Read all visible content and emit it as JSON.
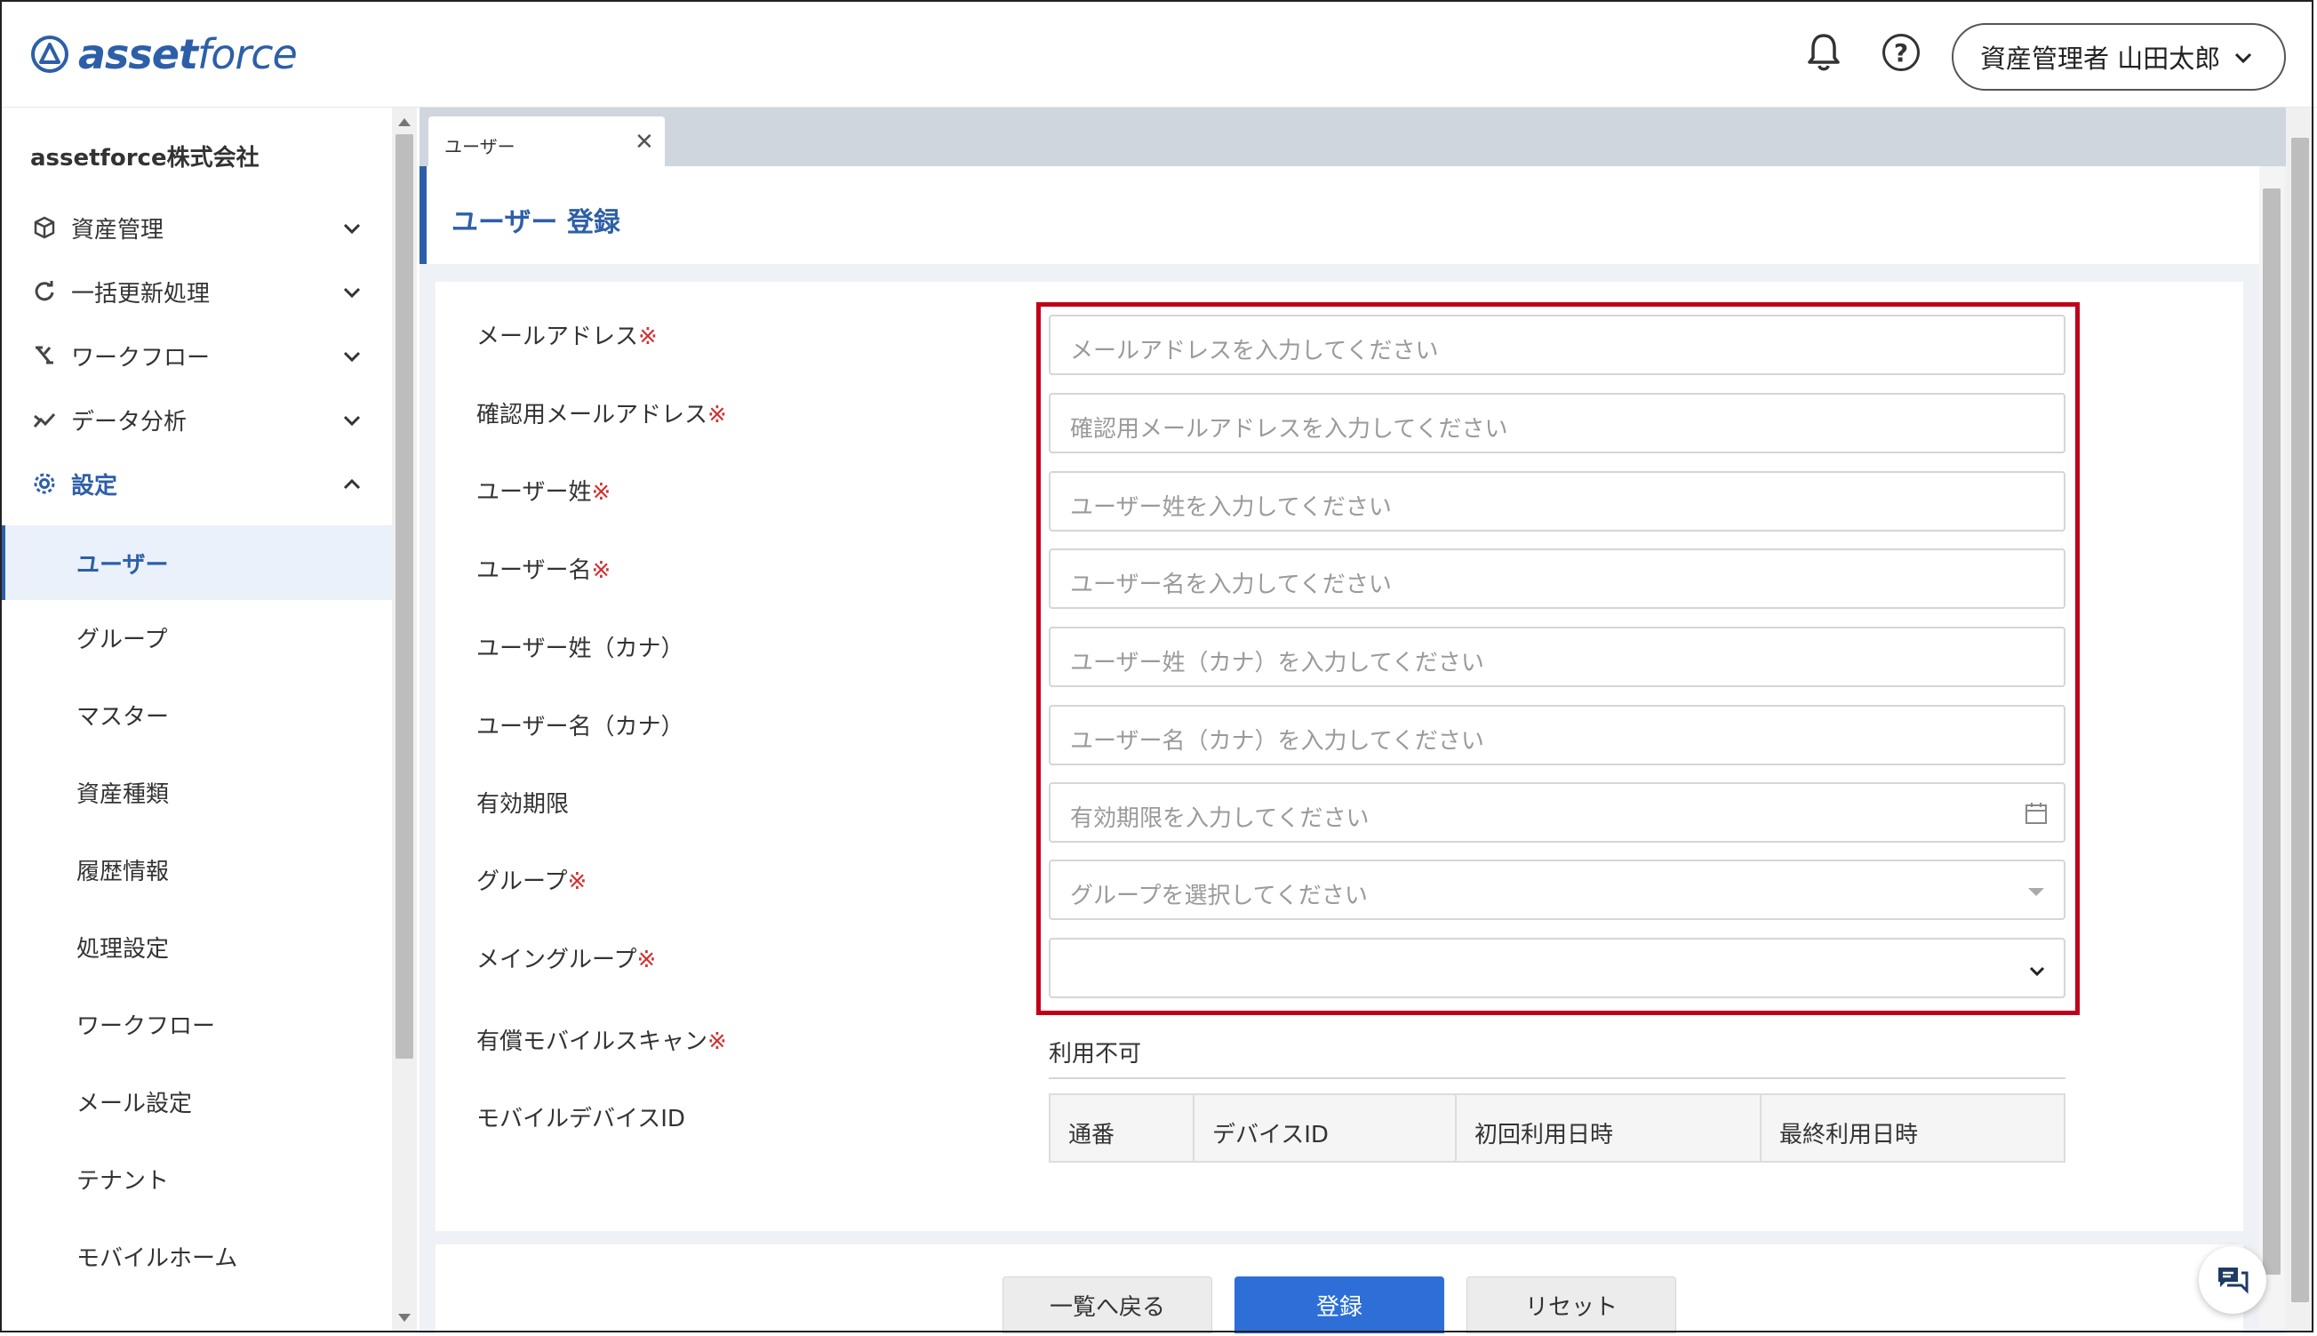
{
  "brand": {
    "logo_prefix": "asset",
    "logo_suffix": "force",
    "accent": "#2d5fa8"
  },
  "header": {
    "user_label": "資産管理者 山田太郎"
  },
  "sidebar": {
    "company": "assetforce株式会社",
    "groups": [
      {
        "label": "資産管理",
        "icon": "box-icon",
        "expanded": false
      },
      {
        "label": "一括更新処理",
        "icon": "refresh-icon",
        "expanded": false
      },
      {
        "label": "ワークフロー",
        "icon": "workflow-icon",
        "expanded": false
      },
      {
        "label": "データ分析",
        "icon": "chart-icon",
        "expanded": false
      },
      {
        "label": "設定",
        "icon": "gear-icon",
        "expanded": true
      }
    ],
    "settings_items": [
      {
        "label": "ユーザー",
        "selected": true
      },
      {
        "label": "グループ"
      },
      {
        "label": "マスター"
      },
      {
        "label": "資産種類"
      },
      {
        "label": "履歴情報"
      },
      {
        "label": "処理設定"
      },
      {
        "label": "ワークフロー"
      },
      {
        "label": "メール設定"
      },
      {
        "label": "テナント"
      },
      {
        "label": "モバイルホーム"
      }
    ]
  },
  "tabs": [
    {
      "label": "ユーザー"
    }
  ],
  "page": {
    "title": "ユーザー 登録",
    "required_mark": "※",
    "fields": [
      {
        "label": "メールアドレス",
        "required": true,
        "placeholder": "メールアドレスを入力してください"
      },
      {
        "label": "確認用メールアドレス",
        "required": true,
        "placeholder": "確認用メールアドレスを入力してください"
      },
      {
        "label": "ユーザー姓",
        "required": true,
        "placeholder": "ユーザー姓を入力してください"
      },
      {
        "label": "ユーザー名",
        "required": true,
        "placeholder": "ユーザー名を入力してください"
      },
      {
        "label": "ユーザー姓（カナ）",
        "required": false,
        "placeholder": "ユーザー姓（カナ）を入力してください"
      },
      {
        "label": "ユーザー名（カナ）",
        "required": false,
        "placeholder": "ユーザー名（カナ）を入力してください"
      },
      {
        "label": "有効期限",
        "required": false,
        "placeholder": "有効期限を入力してください"
      },
      {
        "label": "グループ",
        "required": true,
        "placeholder": "グループを選択してください"
      },
      {
        "label": "メイングループ",
        "required": true,
        "placeholder": ""
      }
    ],
    "mobile_scan": {
      "label": "有償モバイルスキャン",
      "required": true,
      "value": "利用不可"
    },
    "mobile_device": {
      "label": "モバイルデバイスID",
      "columns": [
        "通番",
        "デバイスID",
        "初回利用日時",
        "最終利用日時"
      ]
    }
  },
  "buttons": {
    "back": "一覧へ戻る",
    "register": "登録",
    "reset": "リセット"
  }
}
